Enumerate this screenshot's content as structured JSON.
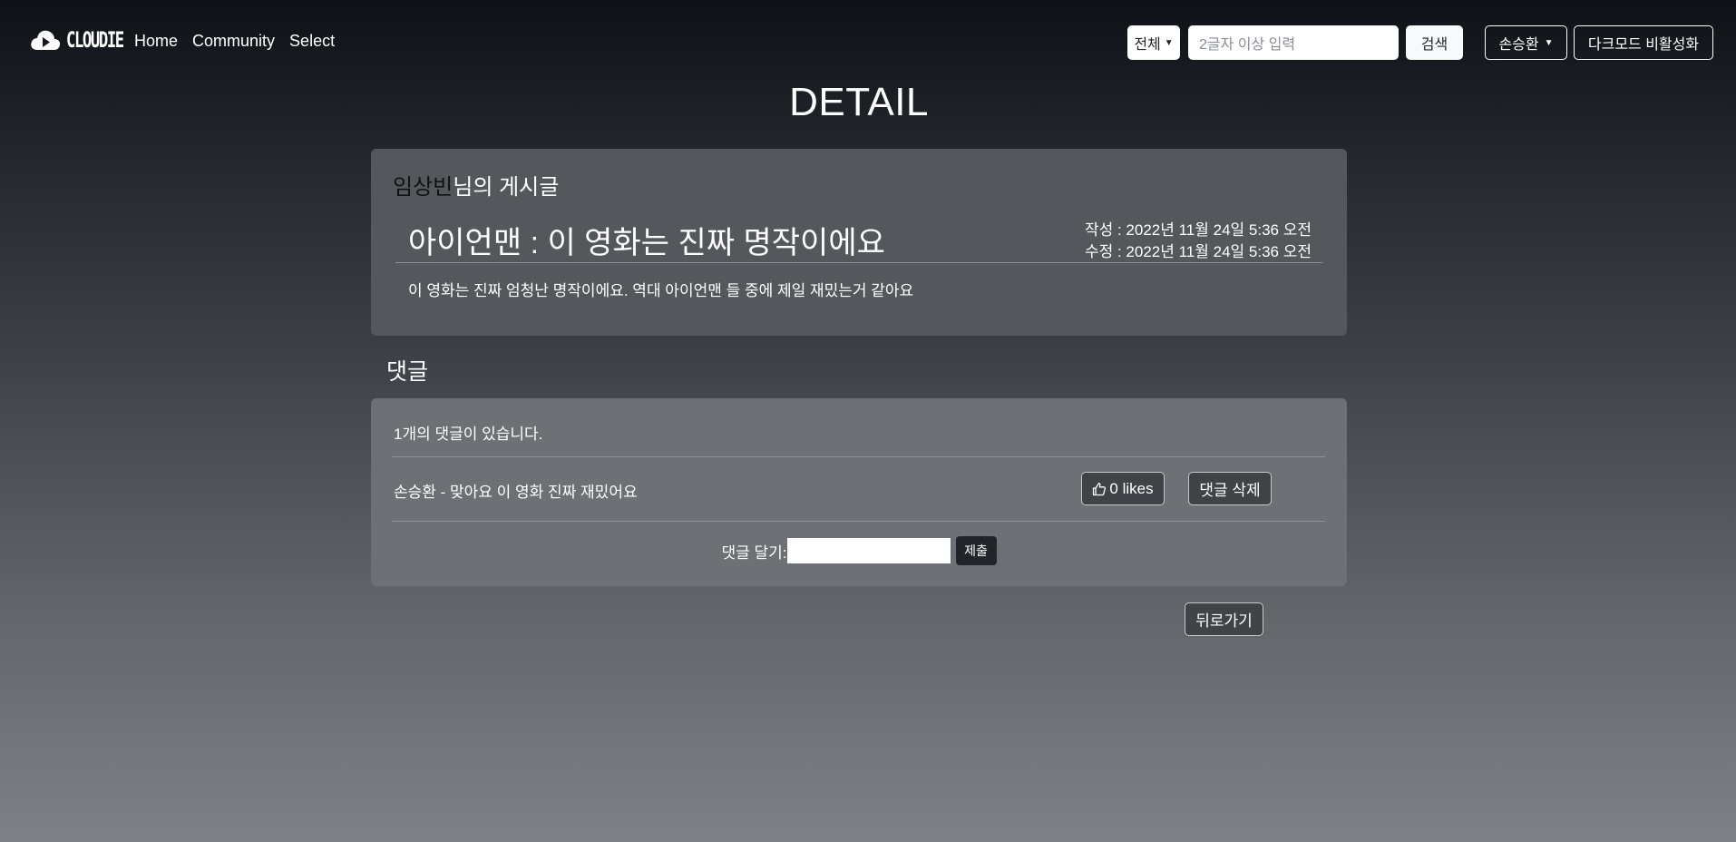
{
  "nav": {
    "brand": "CLOUDIE",
    "links": [
      "Home",
      "Community",
      "Select"
    ],
    "search_scope": "전체",
    "search_placeholder": "2글자 이상 입력",
    "search_button": "검색",
    "user_name": "손승환",
    "dark_mode_toggle": "다크모드 비활성화"
  },
  "page": {
    "title": "DETAIL"
  },
  "post": {
    "author": "임상빈",
    "author_suffix": "님의 게시글",
    "title": "아이언맨 : 이 영화는 진짜 명작이에요",
    "created": "작성 : 2022년 11월 24일 5:36 오전",
    "modified": "수정 : 2022년 11월 24일 5:36 오전",
    "body": "이 영화는 진짜 엄청난 명작이에요. 역대 아이언맨 들 중에 제일 재밌는거 같아요"
  },
  "comments": {
    "heading": "댓글",
    "count_text": "1개의 댓글이 있습니다.",
    "items": [
      {
        "text": "손승환 - 맞아요 이 영화 진짜 재밌어요",
        "likes_label": "0 likes",
        "delete_label": "댓글 삭제"
      }
    ],
    "form_label": "댓글 달기:",
    "submit_label": "제출"
  },
  "back_button": "뒤로가기",
  "icons": {
    "brand": "cloud-play-icon",
    "like": "thumbs-up-icon",
    "dropdown": "caret-down-icon"
  },
  "colors": {
    "post_card_bg": "#54575c",
    "comment_card_bg": "#6d7074",
    "author_name": "#111111"
  }
}
